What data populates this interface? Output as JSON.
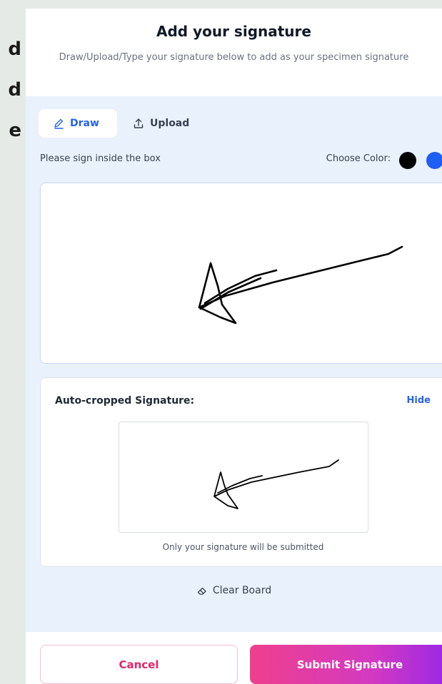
{
  "page_edge_glyphs": [
    "d",
    "d",
    "e"
  ],
  "modal": {
    "title": "Add your signature",
    "subtitle": "Draw/Upload/Type your signature below to add as your specimen signature"
  },
  "tabs": {
    "draw": {
      "label": "Draw",
      "icon": "pencil-icon",
      "active": true
    },
    "upload": {
      "label": "Upload",
      "icon": "upload-icon",
      "active": false
    }
  },
  "canvas": {
    "hint": "Please sign inside the box",
    "choose_color_label": "Choose Color:",
    "colors": [
      {
        "name": "black",
        "hex": "#000000",
        "selected": true
      },
      {
        "name": "blue",
        "hex": "#1e5ef2",
        "selected": false
      }
    ],
    "stroke_color": "#000000"
  },
  "cropped": {
    "title": "Auto-cropped Signature:",
    "hide_label": "Hide",
    "note": "Only your signature will be submitted"
  },
  "clear_board": {
    "label": "Clear Board",
    "icon": "eraser-icon"
  },
  "footer": {
    "cancel_label": "Cancel",
    "submit_label": "Submit Signature"
  },
  "colors": {
    "accent": "#2563eb",
    "panel_bg": "#e8f1fc",
    "cancel_text": "#e0266a",
    "submit_gradient_start": "#ef3f8d",
    "submit_gradient_end": "#9a27e6"
  }
}
